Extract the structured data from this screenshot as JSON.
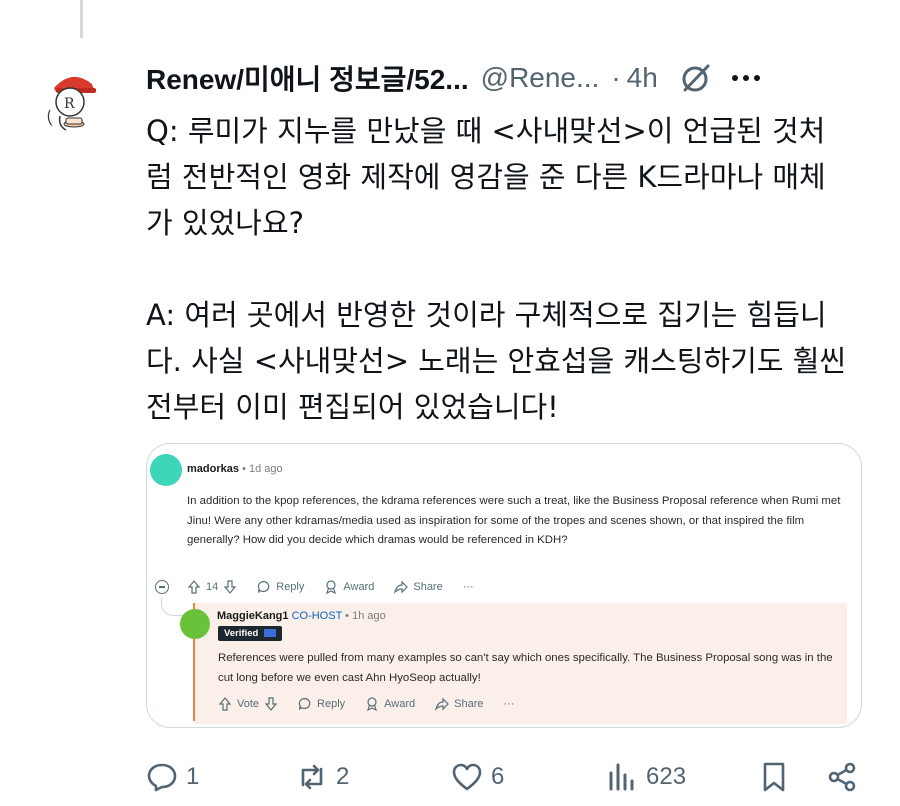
{
  "post": {
    "display_name": "Renew/미애니 정보글/52...",
    "handle": "@Rene...",
    "separator": "·",
    "time": "4h",
    "text_lines_q": [
      "Q: 루미가 지누를 만났을 때 <사내맞선>이 언급된 것처",
      "럼 전반적인 영화 제작에 영감을 준 다른 K드라마나 매체",
      "가 있었나요?"
    ],
    "text_lines_a": [
      "A: 여러 곳에서 반영한 것이라 구체적으로 집기는 힘듭니",
      "다. 사실 <사내맞선> 노래는 안효섭을 캐스팅하기도 훨씬",
      "전부터 이미 편집되어 있었습니다!"
    ]
  },
  "embedded": {
    "comment": {
      "username": "madorkas",
      "meta": "• 1d ago",
      "body": "In addition to the kpop references, the kdrama references were such a treat, like the Business Proposal reference when Rumi met Jinu! Were any other kdramas/media used as inspiration for some of the tropes and scenes shown, or that inspired the film generally? How did you decide which dramas would be referenced in KDH?",
      "votes": "14",
      "reply": "Reply",
      "award": "Award",
      "share": "Share",
      "more": "···"
    },
    "reply": {
      "username": "MaggieKang1",
      "role": "CO-HOST",
      "meta": "• 1h ago",
      "badge": "Verified",
      "body": "References were pulled from many examples so can't say which ones specifically. The Business Proposal song was in the cut long before we even cast Ahn HyoSeop actually!",
      "vote": "Vote",
      "reply": "Reply",
      "award": "Award",
      "share": "Share",
      "more": "···"
    }
  },
  "stats": {
    "replies": "1",
    "reposts": "2",
    "likes": "6",
    "views": "623"
  },
  "colors": {
    "text": "#0f1419",
    "secondary": "#536471",
    "reply_accent": "#e8823e",
    "reply_bg": "#fbefe9",
    "cohost": "#0a66c2"
  },
  "icons": [
    "grok-icon",
    "more-icon",
    "reply-icon",
    "repost-icon",
    "like-icon",
    "views-icon",
    "bookmark-icon",
    "share-icon"
  ]
}
